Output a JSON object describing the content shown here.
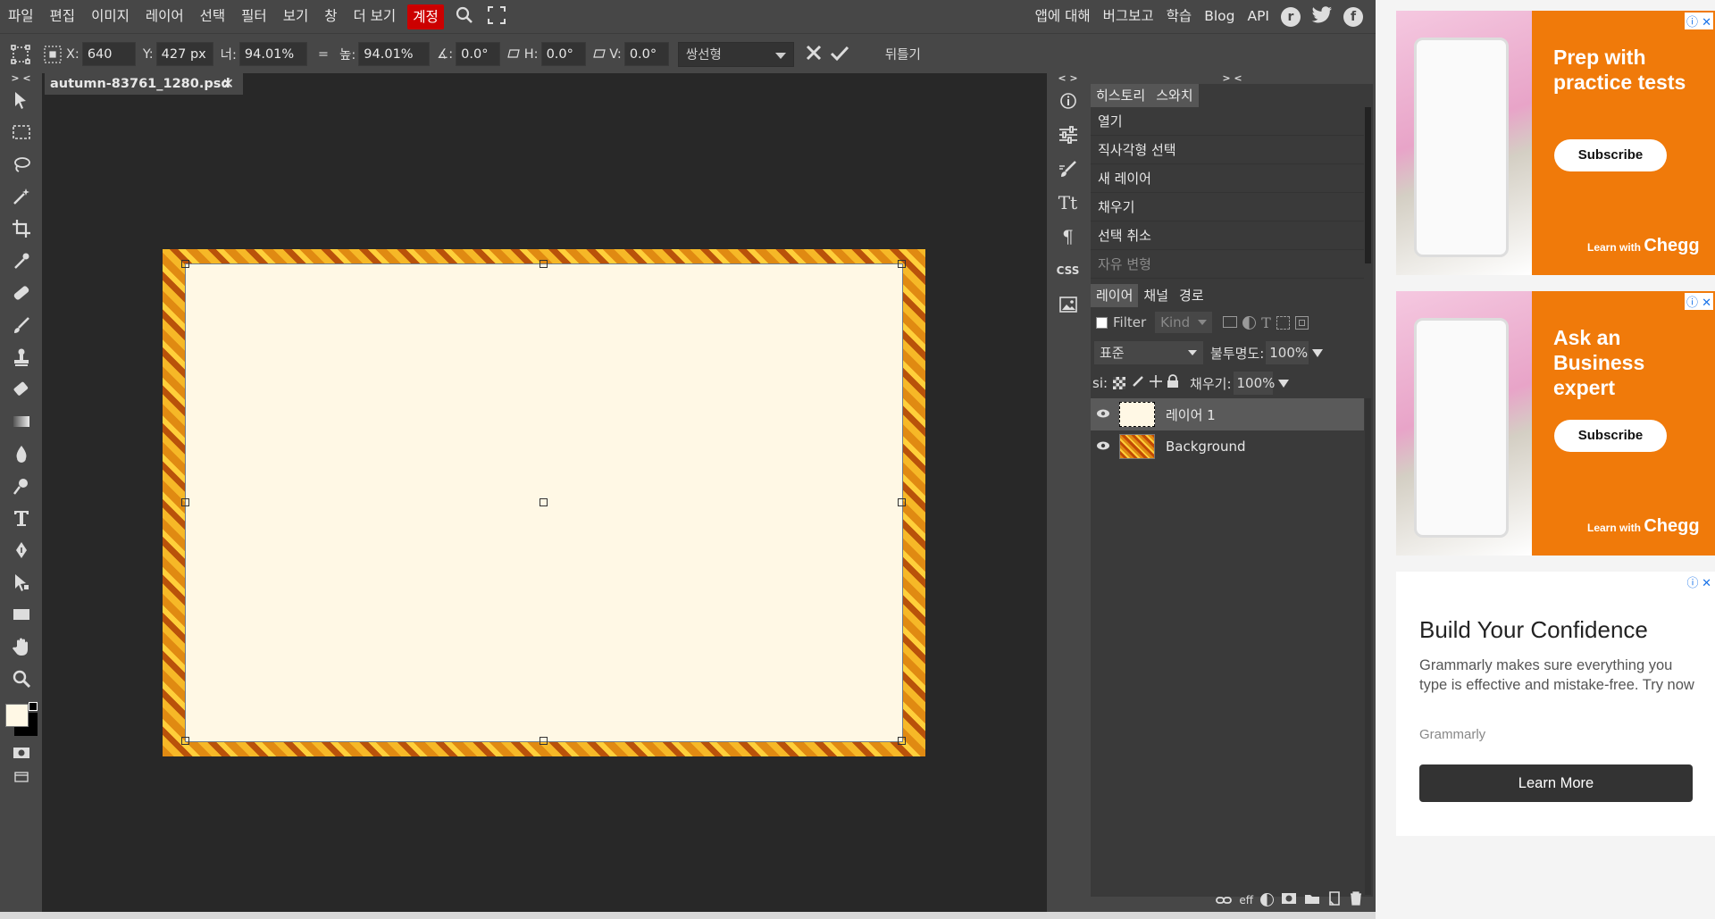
{
  "menu": {
    "items": [
      "파일",
      "편집",
      "이미지",
      "레이어",
      "선택",
      "필터",
      "보기",
      "창",
      "더 보기",
      "계정"
    ],
    "right": [
      "앱에 대해",
      "버그보고",
      "학습",
      "Blog",
      "API"
    ]
  },
  "options": {
    "x_label": "X:",
    "x_value": "640 px",
    "y_label": "Y:",
    "y_value": "427 px",
    "w_label": "너:",
    "w_value": "94.01%",
    "link": "=",
    "h_label": "높:",
    "h_value": "94.01%",
    "angle_label": "∡:",
    "angle_value": "0.0°",
    "skew_h_label": "H:",
    "skew_h_value": "0.0°",
    "skew_v_label": "V:",
    "skew_v_value": "0.0°",
    "interp": "쌍선형",
    "flip": "뒤틀기"
  },
  "document": {
    "tab": "autumn-83761_1280.psd"
  },
  "history": {
    "tabs": [
      "히스토리",
      "스와치"
    ],
    "items": [
      "열기",
      "직사각형 선택",
      "새 레이어",
      "채우기",
      "선택 취소",
      "자유 변형"
    ]
  },
  "layers": {
    "tabs": [
      "레이어",
      "채널",
      "경로"
    ],
    "filter_label": "Filter",
    "kind": "Kind",
    "blend": "표준",
    "opacity_label": "불투명도:",
    "opacity": "100%",
    "lock_label": "si:",
    "fill_label": "채우기:",
    "fill": "100%",
    "items": [
      {
        "name": "레이어 1"
      },
      {
        "name": "Background"
      }
    ],
    "footer_eff": "eff"
  },
  "ads": {
    "ad1_title": "Prep with practice tests",
    "ad1_btn": "Subscribe",
    "ad2_title": "Ask an Business expert",
    "ad2_btn": "Subscribe",
    "chegg_prefix": "Learn with",
    "chegg_brand": "Chegg",
    "ad3_title": "Build Your Confidence",
    "ad3_body": "Grammarly makes sure everything you type is effective and mistake-free. Try now",
    "ad3_brand": "Grammarly",
    "ad3_btn": "Learn More"
  },
  "colors": {
    "accent": "#cc0000",
    "panel": "#474747",
    "canvas": "#282828",
    "layer_fill": "#fff8e5"
  }
}
